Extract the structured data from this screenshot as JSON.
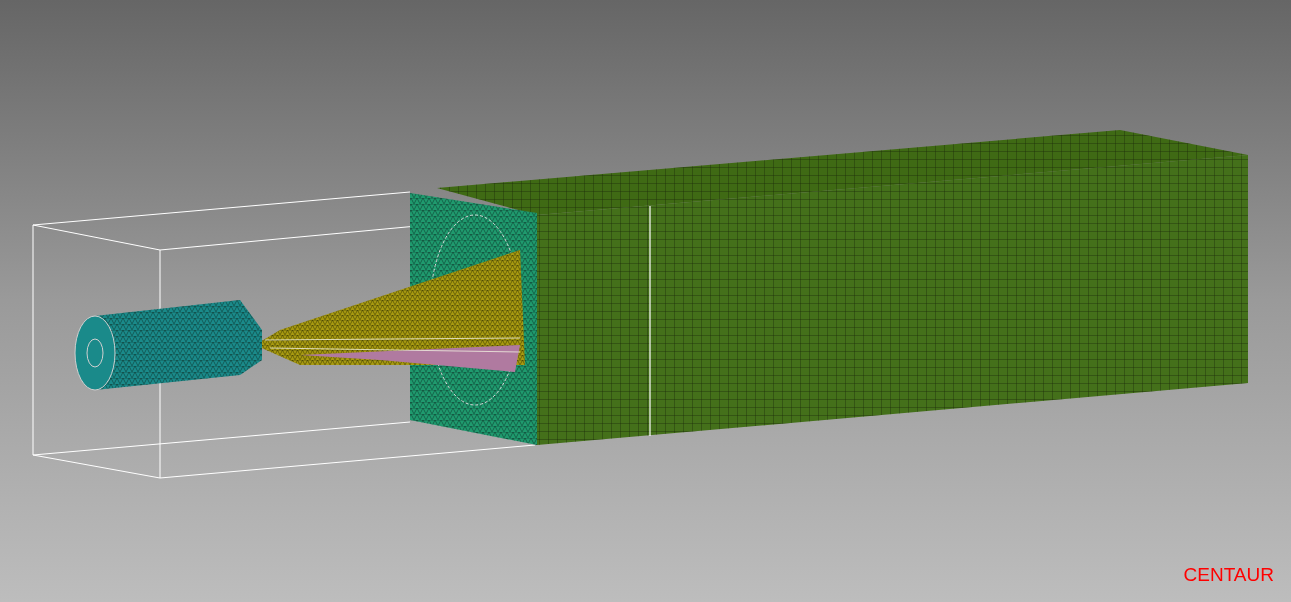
{
  "viewport": {
    "label": "CENTAUR"
  }
}
